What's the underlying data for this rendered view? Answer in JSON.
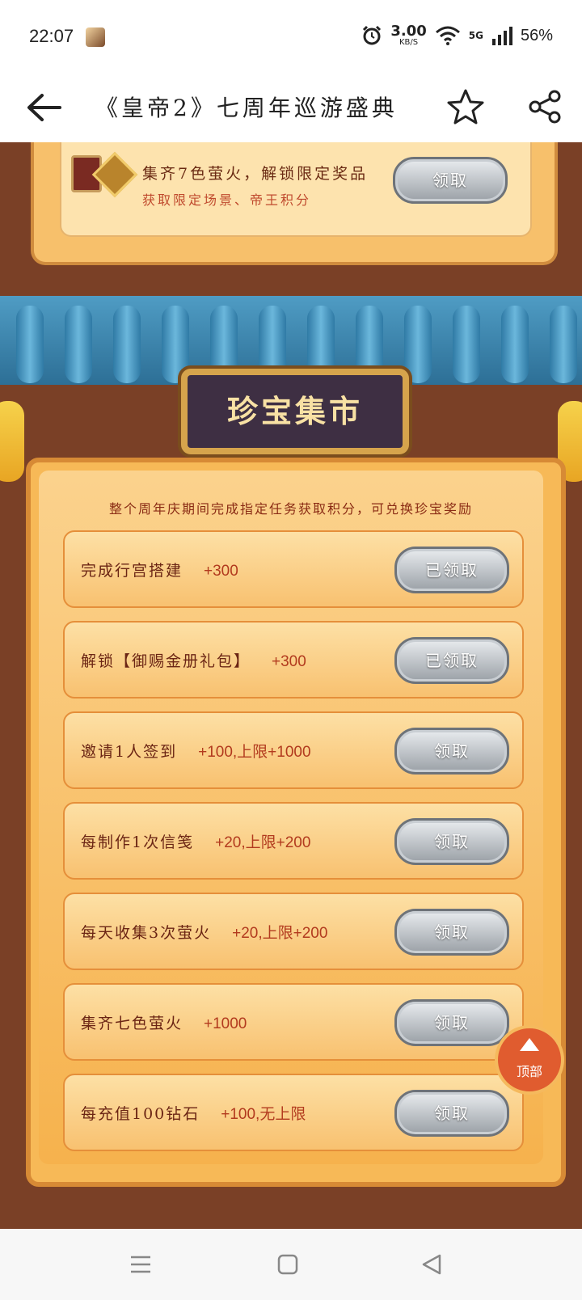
{
  "status_bar": {
    "time": "22:07",
    "speed_value": "3.00",
    "speed_unit": "KB/S",
    "network": "5G",
    "battery": "56%"
  },
  "app_bar": {
    "title": "《皇帝2》七周年巡游盛典"
  },
  "top_reward": {
    "line1": "集齐7色萤火，解锁限定奖品",
    "line2": "获取限定场景、帝王积分",
    "button": "领取"
  },
  "section_title": "珍宝集市",
  "description": "整个周年庆期间完成指定任务获取积分，可兑换珍宝奖励",
  "tasks": [
    {
      "name": "完成行宫搭建",
      "points": "+300",
      "button": "已领取"
    },
    {
      "name": "解锁【御赐金册礼包】",
      "points": "+300",
      "button": "已领取"
    },
    {
      "name": "邀请1人签到",
      "points": "+100,上限+1000",
      "button": "领取"
    },
    {
      "name": "每制作1次信笺",
      "points": "+20,上限+200",
      "button": "领取"
    },
    {
      "name": "每天收集3次萤火",
      "points": "+20,上限+200",
      "button": "领取"
    },
    {
      "name": "集齐七色萤火",
      "points": "+1000",
      "button": "领取"
    },
    {
      "name": "每充值100钻石",
      "points": "+100,无上限",
      "button": "领取"
    }
  ],
  "to_top_label": "顶部",
  "icons": [
    "back-arrow-icon",
    "star-icon",
    "share-icon",
    "alarm-icon",
    "wifi-icon",
    "signal-icon",
    "menu-icon",
    "home-icon",
    "back-triangle-icon"
  ],
  "colors": {
    "accent": "#f7b957",
    "button_gray": "#9aa0a6",
    "text_brown": "#6b2514"
  }
}
